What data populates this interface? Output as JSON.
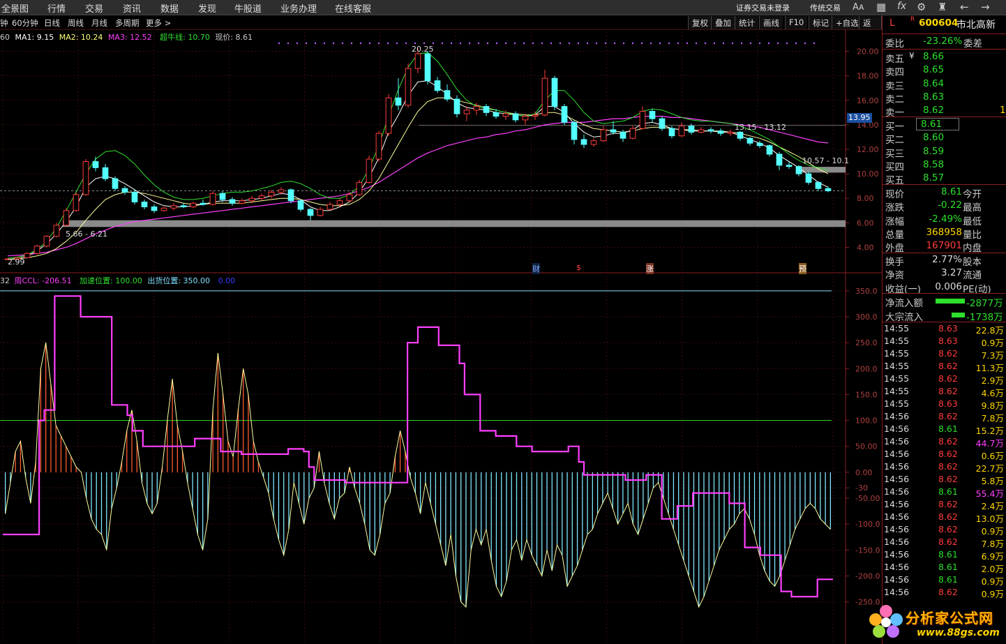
{
  "menu": {
    "items": [
      "全景图",
      "行情",
      "交易",
      "资讯",
      "数据",
      "发现",
      "牛股道",
      "业务办理",
      "在线客服"
    ],
    "right_items": [
      "证券交易未登录",
      "传统交易"
    ],
    "icons": [
      "font-size-icon",
      "grid-icon",
      "fx-icon",
      "gear-icon",
      "shirt-icon",
      "back-arrow-icon",
      "forward-arrow-icon"
    ]
  },
  "period_bar": {
    "periods": [
      "钟",
      "60分钟",
      "日线",
      "周线",
      "月线",
      "多周期",
      "更多 >"
    ],
    "buttons": [
      "复权",
      "叠加",
      "统计",
      "画线",
      "F10",
      "标记",
      "+自选",
      "返回"
    ]
  },
  "main_chart": {
    "legend": {
      "prefix": "60",
      "ma1": "MA1: 9.15",
      "ma2": "MA2: 10.24",
      "ma3": "MA3: 12.52",
      "super": "超牛线: 10.70",
      "price": "现价: 8.61"
    },
    "price_ticks": [
      "20.00",
      "18.00",
      "16.00",
      "14.00",
      "12.00",
      "10.00",
      "8.00",
      "6.00",
      "4.00"
    ],
    "current_price_tag": "13.95",
    "annotations": {
      "high": "20.25",
      "low": "2.99",
      "zone1": "5.66 - 6.21",
      "zone2": "13.15 - 13.12",
      "zone3": "10.57 - 10.1"
    },
    "events": [
      "财",
      "$",
      "涨",
      "预"
    ]
  },
  "indicator": {
    "legend": {
      "prefix": "32",
      "name": "周CCL: -206.51",
      "accel": "加速位置: 100.00",
      "ship": "出货位置: 350.00",
      "extra": "0.00"
    },
    "ticks": [
      "350.0",
      "300.0",
      "250.0",
      "200.0",
      "150.0",
      "100.0",
      "50.00",
      "0.00",
      "-50.00",
      "-100.0",
      "-150.0",
      "-200.0",
      "-250.0",
      "-30"
    ]
  },
  "chart_data": {
    "type": "candlestick",
    "ylim": [
      3,
      21
    ],
    "indicator_ylim": [
      -330,
      370
    ],
    "candles": [
      [
        3.0,
        3.1,
        2.99,
        3.05
      ],
      [
        3.05,
        3.2,
        3.0,
        3.15
      ],
      [
        3.15,
        3.6,
        3.1,
        3.5
      ],
      [
        3.5,
        4.2,
        3.4,
        4.1
      ],
      [
        4.1,
        5.0,
        4.0,
        4.9
      ],
      [
        4.9,
        6.0,
        4.8,
        5.8
      ],
      [
        5.8,
        7.2,
        5.7,
        7.0
      ],
      [
        7.0,
        8.5,
        6.9,
        8.3
      ],
      [
        8.3,
        11.2,
        8.2,
        11.0
      ],
      [
        11.0,
        11.4,
        10.2,
        10.5
      ],
      [
        10.5,
        10.8,
        9.4,
        9.6
      ],
      [
        9.6,
        9.8,
        8.6,
        8.8
      ],
      [
        8.8,
        9.0,
        8.3,
        8.5
      ],
      [
        8.5,
        8.7,
        7.5,
        7.7
      ],
      [
        7.7,
        7.9,
        7.1,
        7.3
      ],
      [
        7.3,
        7.5,
        6.8,
        7.0
      ],
      [
        7.0,
        7.3,
        6.9,
        7.2
      ],
      [
        7.2,
        7.6,
        7.0,
        7.4
      ],
      [
        7.4,
        7.6,
        7.2,
        7.3
      ],
      [
        7.3,
        7.7,
        7.2,
        7.6
      ],
      [
        7.6,
        7.9,
        7.4,
        7.5
      ],
      [
        7.5,
        8.6,
        7.4,
        8.4
      ],
      [
        8.4,
        8.6,
        7.7,
        7.9
      ],
      [
        7.9,
        8.1,
        7.4,
        7.6
      ],
      [
        7.6,
        8.0,
        7.5,
        7.8
      ],
      [
        7.8,
        8.2,
        7.6,
        8.0
      ],
      [
        8.0,
        8.4,
        7.8,
        8.2
      ],
      [
        8.2,
        8.7,
        8.0,
        8.5
      ],
      [
        8.5,
        8.9,
        8.3,
        8.7
      ],
      [
        8.7,
        8.8,
        7.6,
        7.8
      ],
      [
        7.8,
        7.9,
        6.9,
        7.1
      ],
      [
        7.1,
        7.2,
        6.2,
        6.6
      ],
      [
        6.6,
        7.3,
        6.5,
        7.1
      ],
      [
        7.1,
        7.7,
        7.0,
        7.5
      ],
      [
        7.5,
        8.0,
        7.3,
        7.8
      ],
      [
        7.8,
        8.5,
        7.7,
        8.3
      ],
      [
        8.3,
        9.5,
        8.2,
        9.3
      ],
      [
        9.3,
        11.5,
        9.2,
        11.2
      ],
      [
        11.2,
        13.5,
        11.0,
        13.3
      ],
      [
        13.3,
        16.5,
        13.1,
        16.2
      ],
      [
        16.2,
        17.8,
        15.2,
        15.6
      ],
      [
        15.6,
        19.0,
        15.4,
        18.6
      ],
      [
        18.6,
        20.25,
        18.2,
        19.8
      ],
      [
        19.8,
        20.0,
        17.3,
        17.6
      ],
      [
        17.6,
        17.9,
        16.6,
        16.8
      ],
      [
        16.8,
        17.3,
        15.9,
        16.1
      ],
      [
        16.1,
        16.4,
        14.6,
        14.9
      ],
      [
        14.9,
        15.5,
        14.3,
        15.2
      ],
      [
        15.2,
        15.8,
        14.8,
        15.5
      ],
      [
        15.5,
        15.7,
        14.7,
        15.0
      ],
      [
        15.0,
        15.3,
        14.5,
        14.7
      ],
      [
        14.7,
        15.2,
        14.4,
        14.9
      ],
      [
        14.9,
        15.1,
        14.2,
        14.4
      ],
      [
        14.4,
        14.9,
        14.0,
        14.7
      ],
      [
        14.7,
        15.1,
        14.4,
        14.8
      ],
      [
        14.8,
        18.5,
        14.7,
        17.8
      ],
      [
        17.8,
        18.0,
        15.2,
        15.5
      ],
      [
        15.5,
        15.7,
        14.0,
        14.2
      ],
      [
        14.2,
        14.4,
        12.4,
        12.8
      ],
      [
        12.8,
        13.2,
        12.1,
        12.4
      ],
      [
        12.4,
        12.9,
        12.2,
        12.7
      ],
      [
        12.7,
        13.9,
        12.6,
        13.6
      ],
      [
        13.6,
        14.3,
        13.2,
        13.4
      ],
      [
        13.4,
        13.6,
        12.6,
        12.9
      ],
      [
        12.9,
        13.9,
        12.8,
        13.7
      ],
      [
        13.7,
        15.5,
        13.6,
        15.1
      ],
      [
        15.1,
        15.3,
        14.2,
        14.5
      ],
      [
        14.5,
        14.7,
        13.5,
        13.7
      ],
      [
        13.7,
        13.9,
        12.9,
        13.1
      ],
      [
        13.1,
        14.2,
        13.0,
        13.9
      ],
      [
        13.9,
        14.1,
        13.2,
        13.4
      ],
      [
        13.4,
        13.8,
        13.3,
        13.6
      ],
      [
        13.6,
        13.8,
        13.3,
        13.5
      ],
      [
        13.5,
        13.7,
        13.1,
        13.3
      ],
      [
        13.3,
        13.6,
        13.1,
        13.4
      ],
      [
        13.4,
        13.5,
        12.7,
        12.9
      ],
      [
        12.9,
        13.0,
        12.3,
        12.5
      ],
      [
        12.5,
        12.7,
        12.1,
        12.3
      ],
      [
        12.3,
        12.4,
        11.4,
        11.6
      ],
      [
        11.6,
        11.8,
        10.3,
        10.7
      ],
      [
        10.7,
        11.0,
        10.4,
        10.6
      ],
      [
        10.6,
        10.7,
        9.8,
        10.0
      ],
      [
        10.0,
        10.2,
        9.1,
        9.3
      ],
      [
        9.3,
        9.4,
        8.6,
        8.8
      ],
      [
        8.8,
        8.95,
        8.5,
        8.61
      ]
    ],
    "ma_fast": [
      3.0,
      3.1,
      3.3,
      3.7,
      4.3,
      5.1,
      6.1,
      7.3,
      8.9,
      9.6,
      9.8,
      9.6,
      9.2,
      8.7,
      8.2,
      7.7,
      7.4,
      7.3,
      7.3,
      7.4,
      7.5,
      7.7,
      7.8,
      7.8,
      7.8,
      7.9,
      8.0,
      8.2,
      8.4,
      8.3,
      7.9,
      7.3,
      7.0,
      7.0,
      7.3,
      7.7,
      8.5,
      9.7,
      11.3,
      13.4,
      14.8,
      16.4,
      17.5,
      17.6,
      17.1,
      16.5,
      15.8,
      15.4,
      15.3,
      15.2,
      15.0,
      14.9,
      14.8,
      14.7,
      14.8,
      15.5,
      15.5,
      15.0,
      14.1,
      13.4,
      13.0,
      13.1,
      13.3,
      13.3,
      13.6,
      14.1,
      14.2,
      14.0,
      13.7,
      13.6,
      13.5,
      13.5,
      13.5,
      13.4,
      13.4,
      13.1,
      12.8,
      12.5,
      12.1,
      11.5,
      11.0,
      10.5,
      9.9,
      9.3,
      8.9
    ],
    "ma_mid": [
      3.0,
      3.05,
      3.15,
      3.3,
      3.5,
      3.9,
      4.5,
      5.2,
      6.2,
      7.1,
      7.9,
      8.3,
      8.5,
      8.5,
      8.4,
      8.2,
      8.0,
      7.8,
      7.6,
      7.5,
      7.5,
      7.6,
      7.6,
      7.6,
      7.6,
      7.7,
      7.8,
      7.9,
      8.0,
      8.0,
      7.9,
      7.7,
      7.5,
      7.4,
      7.4,
      7.5,
      7.9,
      8.6,
      9.6,
      11.0,
      12.4,
      13.8,
      15.1,
      15.9,
      16.2,
      16.2,
      16.0,
      15.8,
      15.6,
      15.4,
      15.2,
      15.0,
      14.9,
      14.8,
      14.8,
      15.0,
      15.0,
      14.8,
      14.4,
      14.0,
      13.7,
      13.6,
      13.5,
      13.4,
      13.5,
      13.7,
      13.8,
      13.8,
      13.7,
      13.6,
      13.6,
      13.5,
      13.5,
      13.5,
      13.4,
      13.3,
      13.1,
      12.9,
      12.6,
      12.2,
      11.8,
      11.4,
      10.9,
      10.4,
      10.0
    ],
    "ma3": [
      3.3,
      3.35,
      3.4,
      3.5,
      3.6,
      3.8,
      4.0,
      4.3,
      4.7,
      5.1,
      5.4,
      5.7,
      5.9,
      6.1,
      6.2,
      6.3,
      6.4,
      6.5,
      6.6,
      6.7,
      6.8,
      6.9,
      7.0,
      7.1,
      7.2,
      7.3,
      7.4,
      7.5,
      7.6,
      7.7,
      7.8,
      7.9,
      8.0,
      8.1,
      8.2,
      8.4,
      8.6,
      8.9,
      9.3,
      9.8,
      10.3,
      10.8,
      11.3,
      11.7,
      12.0,
      12.3,
      12.5,
      12.7,
      12.9,
      13.0,
      13.2,
      13.3,
      13.5,
      13.6,
      13.8,
      14.0,
      14.1,
      14.2,
      14.2,
      14.2,
      14.3,
      14.4,
      14.5,
      14.5,
      14.6,
      14.7,
      14.7,
      14.7,
      14.6,
      14.6,
      14.5,
      14.4,
      14.3,
      14.2,
      14.1,
      14.0,
      13.9,
      13.8,
      13.6,
      13.4,
      13.2,
      13.0,
      12.8,
      12.6,
      12.52
    ],
    "super_line": [
      3.1,
      3.2,
      3.4,
      3.8,
      4.5,
      5.6,
      7.0,
      8.5,
      10.0,
      11.2,
      11.8,
      11.9,
      11.5,
      10.8,
      9.9,
      9.1,
      8.5,
      8.1,
      7.9,
      7.9,
      8.0,
      8.2,
      8.4,
      8.5,
      8.5,
      8.6,
      8.8,
      9.0,
      9.3,
      9.4,
      9.2,
      8.8,
      8.3,
      8.0,
      8.0,
      8.3,
      9.0,
      10.4,
      12.3,
      14.7,
      16.9,
      18.7,
      19.8,
      19.9,
      19.2,
      18.1,
      16.9,
      16.0,
      15.5,
      15.3,
      15.2,
      15.0,
      14.8,
      14.7,
      14.9,
      16.0,
      16.8,
      16.8,
      16.0,
      15.0,
      14.3,
      14.1,
      14.2,
      14.3,
      14.6,
      15.1,
      15.3,
      15.2,
      14.9,
      14.6,
      14.4,
      14.3,
      14.3,
      14.2,
      14.1,
      13.9,
      13.6,
      13.2,
      12.8,
      12.2,
      11.6,
      11.1,
      10.7,
      10.5,
      10.3
    ],
    "ccl_step": [
      -120,
      -120,
      -120,
      -120,
      -120,
      -120,
      -120,
      100,
      120,
      120,
      340,
      340,
      340,
      340,
      340,
      300,
      300,
      300,
      300,
      300,
      300,
      130,
      130,
      130,
      110,
      80,
      80,
      50,
      50,
      50,
      50,
      50,
      50,
      50,
      50,
      50,
      50,
      65,
      65,
      65,
      65,
      65,
      40,
      40,
      40,
      40,
      35,
      35,
      35,
      35,
      35,
      35,
      35,
      35,
      35,
      45,
      45,
      45,
      40,
      10,
      -15,
      -15,
      -15,
      -15,
      -15,
      -15,
      -20,
      -20,
      -20,
      -20,
      -20,
      -20,
      -20,
      -20,
      -20,
      -20,
      -20,
      -20,
      250,
      250,
      280,
      280,
      280,
      280,
      245,
      245,
      245,
      245,
      210,
      150,
      150,
      150,
      80,
      80,
      80,
      70,
      70,
      70,
      70,
      50,
      50,
      50,
      40,
      40,
      40,
      40,
      40,
      40,
      40,
      50,
      50,
      20,
      -5,
      -5,
      -5,
      -5,
      -5,
      -5,
      -5,
      -5,
      -15,
      -15,
      -15,
      -15,
      -5,
      -5,
      -5,
      -90,
      -90,
      -90,
      -65,
      -65,
      -65,
      -40,
      -40,
      -40,
      -40,
      -40,
      -40,
      -40,
      -60,
      -60,
      -60,
      -145,
      -145,
      -145,
      -160,
      -160,
      -160,
      -160,
      -230,
      -230,
      -240,
      -240,
      -240,
      -240,
      -240,
      -206.51,
      -206.51,
      -206.51
    ],
    "ccl_line": [
      -80,
      -20,
      40,
      60,
      -10,
      -60,
      20,
      200,
      250,
      170,
      90,
      70,
      50,
      30,
      10,
      0,
      -50,
      -90,
      -110,
      -120,
      -150,
      -70,
      -30,
      20,
      80,
      120,
      60,
      -20,
      -60,
      -80,
      -60,
      10,
      100,
      180,
      90,
      40,
      -20,
      -70,
      -120,
      -150,
      -90,
      120,
      230,
      150,
      60,
      30,
      120,
      200,
      150,
      60,
      20,
      -10,
      -40,
      -90,
      -130,
      -160,
      -110,
      -20,
      -60,
      -100,
      -50,
      -30,
      40,
      -20,
      -60,
      -90,
      -50,
      -40,
      10,
      -30,
      -60,
      -100,
      -150,
      -160,
      -120,
      -60,
      -40,
      30,
      80,
      40,
      -10,
      -40,
      -80,
      -20,
      -60,
      -100,
      -140,
      -180,
      -120,
      -200,
      -250,
      -260,
      -150,
      -110,
      -140,
      -110,
      -170,
      -220,
      -240,
      -210,
      -150,
      -130,
      -170,
      -130,
      -160,
      -180,
      -200,
      -150,
      -190,
      -140,
      -160,
      -220,
      -200,
      -180,
      -150,
      -120,
      -110,
      -80,
      -60,
      -40,
      -70,
      -100,
      -80,
      -60,
      -100,
      -120,
      -90,
      -60,
      -30,
      -20,
      -50,
      -80,
      -110,
      -140,
      -170,
      -200,
      -230,
      -260,
      -240,
      -210,
      -180,
      -150,
      -130,
      -110,
      -100,
      -80,
      -70,
      -90,
      -120,
      -160,
      -190,
      -210,
      -220,
      -200,
      -170,
      -140,
      -110,
      -90,
      -70,
      -60,
      -70,
      -90,
      -100,
      -110
    ]
  },
  "quote": {
    "code": "600604",
    "name": "市北高新",
    "mark_l": "L",
    "mark_r": "R",
    "weibi_label": "委比",
    "weibi": "-23.26%",
    "weicha_label": "委差",
    "asks": [
      {
        "label": "卖五",
        "price": "8.66",
        "vol": ""
      },
      {
        "label": "卖四",
        "price": "8.65",
        "vol": ""
      },
      {
        "label": "卖三",
        "price": "8.64",
        "vol": ""
      },
      {
        "label": "卖二",
        "price": "8.63",
        "vol": ""
      },
      {
        "label": "卖一",
        "price": "8.62",
        "vol": "1"
      }
    ],
    "bids": [
      {
        "label": "买一",
        "price": "8.61"
      },
      {
        "label": "买二",
        "price": "8.60"
      },
      {
        "label": "买三",
        "price": "8.59"
      },
      {
        "label": "买四",
        "price": "8.58"
      },
      {
        "label": "买五",
        "price": "8.57"
      }
    ],
    "yen": "¥",
    "stats": [
      {
        "l1": "现价",
        "v1": "8.61",
        "c1": "g",
        "l2": "今开"
      },
      {
        "l1": "涨跌",
        "v1": "-0.22",
        "c1": "g",
        "l2": "最高"
      },
      {
        "l1": "涨幅",
        "v1": "-2.49%",
        "c1": "g",
        "l2": "最低"
      },
      {
        "l1": "总量",
        "v1": "368958",
        "c1": "y",
        "l2": "量比"
      },
      {
        "l1": "外盘",
        "v1": "167901",
        "c1": "r",
        "l2": "内盘"
      }
    ],
    "stats2": [
      {
        "l1": "换手",
        "v1": "2.77%",
        "l2": "股本"
      },
      {
        "l1": "净资",
        "v1": "3.27",
        "l2": "流通"
      },
      {
        "l1": "收益(一)",
        "v1": "0.006",
        "l2": "PE(动)"
      }
    ],
    "flows": [
      {
        "label": "净流入额",
        "value": "-2877万",
        "bar": 0.55
      },
      {
        "label": "大宗流入",
        "value": "-1738万",
        "bar": 0.25
      }
    ],
    "ticks": [
      [
        "14:55",
        "8.63",
        "22.8万"
      ],
      [
        "14:55",
        "8.63",
        "0.9万"
      ],
      [
        "14:55",
        "8.62",
        "7.3万"
      ],
      [
        "14:55",
        "8.62",
        "11.3万"
      ],
      [
        "14:55",
        "8.62",
        "2.9万"
      ],
      [
        "14:55",
        "8.62",
        "4.6万"
      ],
      [
        "14:55",
        "8.63",
        "9.8万"
      ],
      [
        "14:56",
        "8.62",
        "7.8万"
      ],
      [
        "14:56",
        "8.61",
        "15.2万"
      ],
      [
        "14:56",
        "8.62",
        "44.7万"
      ],
      [
        "14:56",
        "8.62",
        "0.6万"
      ],
      [
        "14:56",
        "8.62",
        "22.7万"
      ],
      [
        "14:56",
        "8.62",
        "5.8万"
      ],
      [
        "14:56",
        "8.61",
        "55.4万"
      ],
      [
        "14:56",
        "8.62",
        "2.4万"
      ],
      [
        "14:56",
        "8.62",
        "13.0万"
      ],
      [
        "14:56",
        "8.62",
        "0.9万"
      ],
      [
        "14:56",
        "8.62",
        "7.8万"
      ],
      [
        "14:56",
        "8.61",
        "6.9万"
      ],
      [
        "14:56",
        "8.61",
        "2.0万"
      ],
      [
        "14:56",
        "8.61",
        "0.9万"
      ],
      [
        "14:56",
        "8.62",
        "0.9万"
      ]
    ]
  },
  "watermark": {
    "brand": "分析家公式网",
    "url": "www.88gs.com"
  }
}
